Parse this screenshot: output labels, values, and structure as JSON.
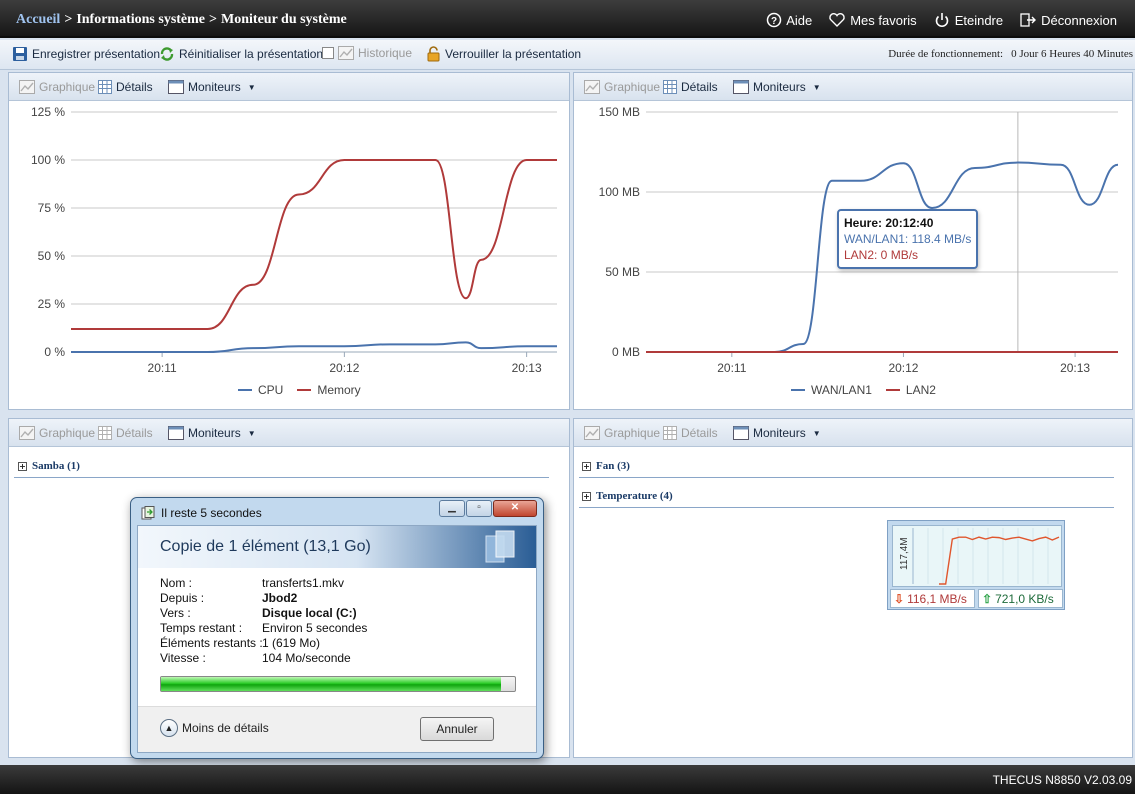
{
  "header": {
    "breadcrumb": [
      "Accueil",
      "Informations système",
      "Moniteur du système"
    ],
    "separator": ">",
    "nav": [
      {
        "label": "Aide",
        "icon": "help-icon"
      },
      {
        "label": "Mes favoris",
        "icon": "heart-icon"
      },
      {
        "label": "Eteindre",
        "icon": "power-icon"
      },
      {
        "label": "Déconnexion",
        "icon": "logout-icon"
      }
    ]
  },
  "toolbar": {
    "save": "Enregistrer présentation",
    "reset": "Réinitialiser la présentation",
    "history": "Historique",
    "lock": "Verrouiller la présentation",
    "uptime_label": "Durée de fonctionnement:",
    "uptime_value": "0 Jour 6 Heures 40 Minutes"
  },
  "panel_head": {
    "graph": "Graphique",
    "details": "Détails",
    "monitors": "Moniteurs"
  },
  "cpu_chart": {
    "chart_data": {
      "type": "line",
      "x": [
        "20:10:30",
        "20:10:45",
        "20:11:00",
        "20:11:15",
        "20:11:30",
        "20:11:45",
        "20:12:00",
        "20:12:15",
        "20:12:30",
        "20:12:40",
        "20:12:45",
        "20:13:00",
        "20:13:10"
      ],
      "series": [
        {
          "name": "CPU",
          "color": "#4a73ad",
          "values": [
            0,
            0,
            0,
            0,
            2,
            3,
            3,
            4,
            4,
            5,
            2,
            3,
            3
          ]
        },
        {
          "name": "Memory",
          "color": "#b03a3a",
          "values": [
            12,
            12,
            12,
            12,
            35,
            82,
            100,
            100,
            100,
            28,
            48,
            100,
            100
          ]
        }
      ],
      "yticks": [
        "0 %",
        "25 %",
        "50 %",
        "75 %",
        "100 %",
        "125 %"
      ],
      "xticks": [
        "20:11",
        "20:12",
        "20:13"
      ],
      "ylim": [
        0,
        125
      ],
      "grid": true,
      "legend": "bottom"
    }
  },
  "net_chart": {
    "chart_data": {
      "type": "line",
      "x": [
        "20:10:30",
        "20:11:00",
        "20:11:15",
        "20:11:25",
        "20:11:35",
        "20:11:45",
        "20:12:00",
        "20:12:10",
        "20:12:25",
        "20:12:40",
        "20:12:55",
        "20:13:05",
        "20:13:15"
      ],
      "series": [
        {
          "name": "WAN/LAN1",
          "color": "#4a73ad",
          "values": [
            0,
            0,
            0,
            5,
            107,
            107,
            118,
            90,
            115,
            118.4,
            117,
            92,
            117
          ]
        },
        {
          "name": "LAN2",
          "color": "#b03a3a",
          "values": [
            0,
            0,
            0,
            0,
            0,
            0,
            0,
            0,
            0,
            0,
            0,
            0,
            0
          ]
        }
      ],
      "yticks": [
        "0 MB",
        "50 MB",
        "100 MB",
        "150 MB"
      ],
      "xticks": [
        "20:11",
        "20:12",
        "20:13"
      ],
      "ylim": [
        0,
        150
      ],
      "grid": true,
      "legend": "bottom"
    },
    "tooltip": {
      "title": "Heure: 20:12:40",
      "wan": "WAN/LAN1: 118.4 MB/s",
      "lan": "LAN2: 0 MB/s"
    }
  },
  "samba_panel": {
    "section": "Samba (1)"
  },
  "hw_panel": {
    "fan": "Fan (3)",
    "temperature": "Temperature (4)"
  },
  "copy_dialog": {
    "title": "Il reste 5 secondes",
    "heading": "Copie de 1 élément (13,1 Go)",
    "rows": [
      {
        "key": "Nom :",
        "value": "transferts1.mkv"
      },
      {
        "key": "Depuis :",
        "value": "Jbod2"
      },
      {
        "key": "Vers :",
        "value": "Disque local (C:)"
      },
      {
        "key": "Temps restant :",
        "value": "Environ 5 secondes"
      },
      {
        "key": "Éléments restants :",
        "value": "1 (619 Mo)"
      },
      {
        "key": "Vitesse :",
        "value": "104 Mo/seconde"
      }
    ],
    "progress": 0.96,
    "less_details": "Moins de détails",
    "cancel": "Annuler"
  },
  "mini_monitor": {
    "axis_label": "117,4M",
    "down": "116,1 MB/s",
    "up": "721,0 KB/s",
    "chart_data": {
      "type": "line",
      "series": [
        {
          "name": "",
          "color": "#e0562d",
          "values": [
            0,
            0,
            96,
            100,
            100,
            95,
            100,
            96,
            100,
            99,
            95,
            98,
            100,
            96,
            92,
            97,
            100,
            94,
            100
          ]
        }
      ],
      "ylim": [
        0,
        117.4
      ]
    }
  },
  "footer": {
    "version": "THECUS N8850 V2.03.09"
  }
}
